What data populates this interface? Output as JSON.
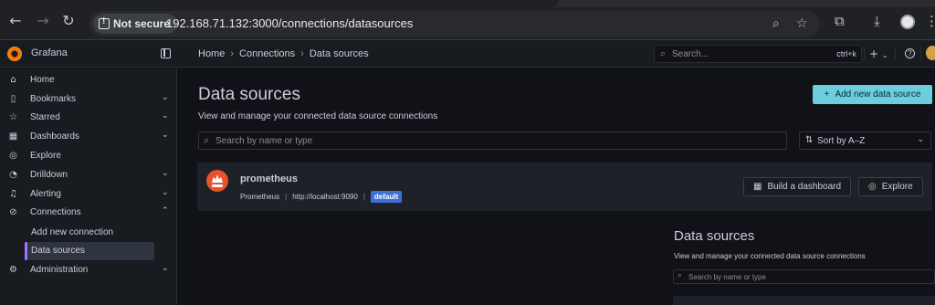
{
  "browser": {
    "not_secure_label": "Not secure",
    "url": "192.168.71.132:3000/connections/datasources"
  },
  "topbar": {
    "brand": "Grafana",
    "breadcrumb": [
      "Home",
      "Connections",
      "Data sources"
    ],
    "search_placeholder": "Search...",
    "search_shortcut": "ctrl+k",
    "plus_label": "+"
  },
  "sidebar": {
    "items": [
      {
        "label": "Home",
        "icon": "home-icon"
      },
      {
        "label": "Bookmarks",
        "icon": "bookmark-icon"
      },
      {
        "label": "Starred",
        "icon": "star-icon"
      },
      {
        "label": "Dashboards",
        "icon": "dashboards-icon"
      },
      {
        "label": "Explore",
        "icon": "compass-icon"
      },
      {
        "label": "Drilldown",
        "icon": "drilldown-icon"
      },
      {
        "label": "Alerting",
        "icon": "bell-icon"
      },
      {
        "label": "Connections",
        "icon": "connections-icon"
      },
      {
        "label": "Administration",
        "icon": "gear-icon"
      }
    ],
    "sub_items": [
      "Add new connection",
      "Data sources"
    ]
  },
  "main": {
    "title": "Data sources",
    "subtitle": "View and manage your connected data source connections",
    "add_button": "Add new data source",
    "search_placeholder": "Search by name or type",
    "sort_label": "Sort by A–Z",
    "datasource": {
      "name": "prometheus",
      "type": "Prometheus",
      "url": "http://localhost:9090",
      "badge": "default",
      "build_button": "Build a dashboard",
      "explore_button": "Explore"
    }
  },
  "ghost": {
    "title": "Data sources",
    "subtitle": "View and manage your connected data source connections",
    "search_placeholder": "Search by name or type"
  },
  "colors": {
    "accent": "#6ccddf",
    "active_marker": "#a571ff",
    "badge": "#3d71d9",
    "prometheus": "#e6522c"
  }
}
